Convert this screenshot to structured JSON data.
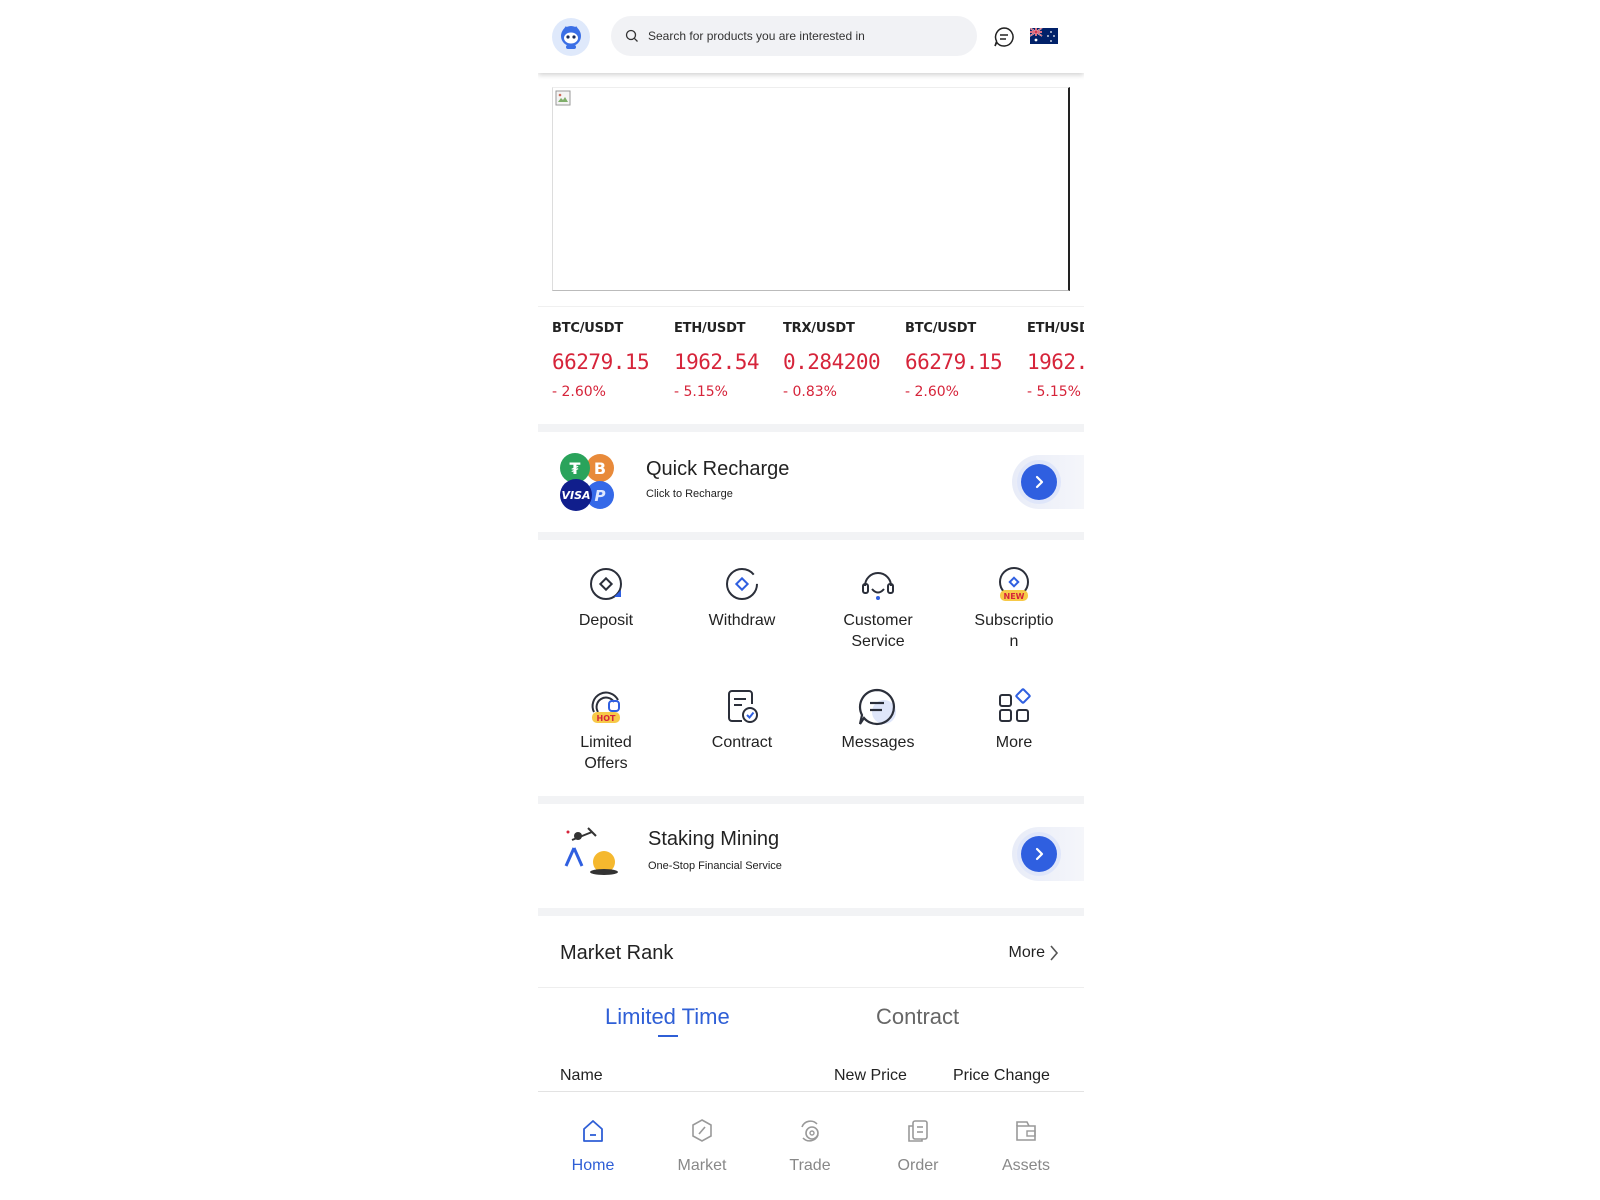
{
  "header": {
    "search_placeholder": "Search for products you are interested in",
    "flag_icon": "australia-flag-icon"
  },
  "tickers": [
    {
      "pair": "BTC/USDT",
      "price": "66279.15",
      "change": "- 2.60%"
    },
    {
      "pair": "ETH/USDT",
      "price": "1962.54",
      "change": "- 5.15%"
    },
    {
      "pair": "TRX/USDT",
      "price": "0.284200",
      "change": "- 0.83%"
    },
    {
      "pair": "BTC/USDT",
      "price": "66279.15",
      "change": "- 2.60%"
    },
    {
      "pair": "ETH/USDT",
      "price": "1962.",
      "change": "- 5.15%"
    }
  ],
  "quick_recharge": {
    "title": "Quick Recharge",
    "subtitle": "Click to Recharge",
    "badge_visa": "VISA"
  },
  "grid": {
    "deposit": "Deposit",
    "withdraw": "Withdraw",
    "customer_service_1": "Customer",
    "customer_service_2": "Service",
    "subscription_1": "Subscriptio",
    "subscription_2": "n",
    "subscription_badge": "NEW",
    "limited_offers_1": "Limited",
    "limited_offers_2": "Offers",
    "limited_badge": "HOT",
    "contract": "Contract",
    "messages": "Messages",
    "more": "More"
  },
  "staking": {
    "title": "Staking Mining",
    "subtitle": "One-Stop Financial Service"
  },
  "market_rank": {
    "title": "Market Rank",
    "more": "More",
    "tabs": [
      "Limited Time",
      "Contract"
    ],
    "columns": [
      "Name",
      "New Price",
      "Price Change"
    ]
  },
  "bottom_nav": [
    "Home",
    "Market",
    "Trade",
    "Order",
    "Assets"
  ],
  "colors": {
    "accent": "#2f5fd6",
    "negative": "#d6243a"
  }
}
